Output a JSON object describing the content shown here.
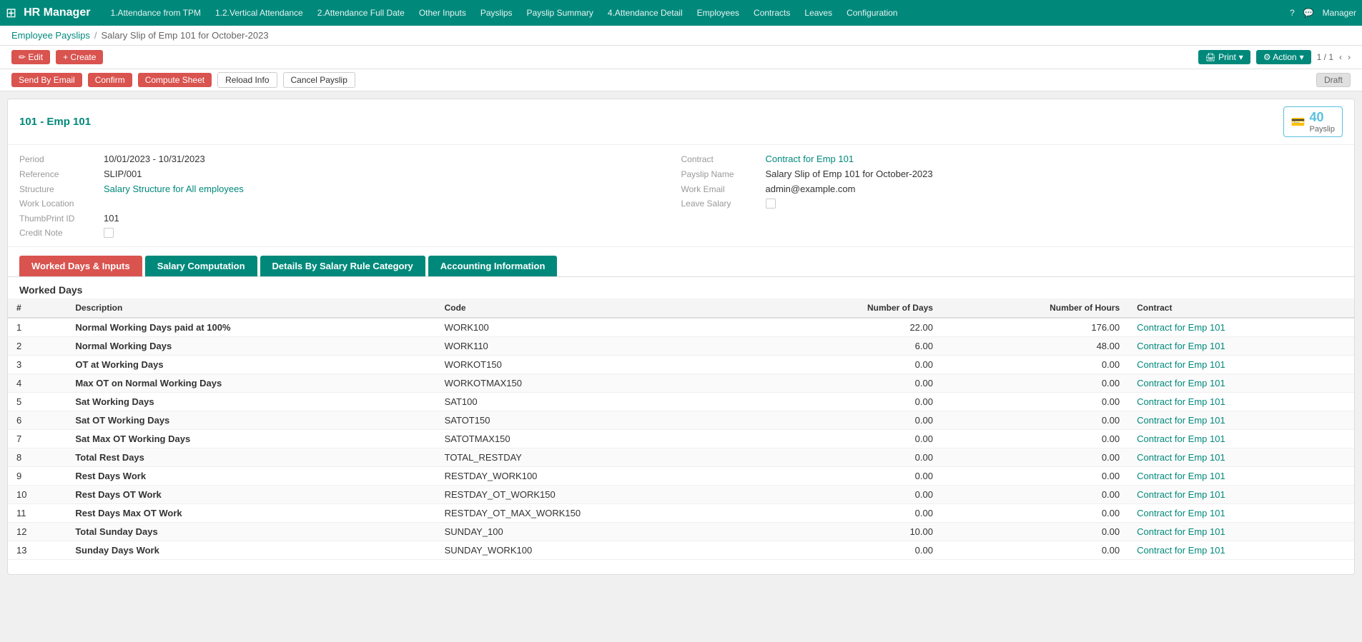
{
  "app": {
    "title": "HR Manager",
    "grid_icon": "⊞"
  },
  "nav": {
    "links": [
      {
        "label": "1.Attendance from TPM",
        "active": false
      },
      {
        "label": "1.2.Vertical Attendance",
        "active": false
      },
      {
        "label": "2.Attendance Full Date",
        "active": false
      },
      {
        "label": "Other Inputs",
        "active": false
      },
      {
        "label": "Payslips",
        "active": false
      },
      {
        "label": "Payslip Summary",
        "active": false
      },
      {
        "label": "4.Attendance Detail",
        "active": false
      },
      {
        "label": "Employees",
        "active": false
      },
      {
        "label": "Contracts",
        "active": false
      },
      {
        "label": "Leaves",
        "active": false
      },
      {
        "label": "Configuration",
        "active": false
      }
    ],
    "right": {
      "help_icon": "?",
      "chat_icon": "💬",
      "user_label": "Manager"
    }
  },
  "breadcrumb": {
    "parent_label": "Employee Payslips",
    "separator": "/",
    "current": "Salary Slip of Emp 101 for October-2023"
  },
  "toolbar": {
    "edit_label": "✏ Edit",
    "create_label": "+ Create",
    "print_label": "🖨 Print",
    "action_label": "⚙ Action",
    "pagination": "1 / 1"
  },
  "status_buttons": {
    "send_by_email": "Send By Email",
    "confirm": "Confirm",
    "compute_sheet": "Compute Sheet",
    "reload_info": "Reload Info",
    "cancel_payslip": "Cancel Payslip",
    "draft": "Draft"
  },
  "employee": {
    "code": "101",
    "name": "Emp 101",
    "payslip_count": "40",
    "payslip_label": "Payslip"
  },
  "form": {
    "left": {
      "period_label": "Period",
      "period_value": "10/01/2023 - 10/31/2023",
      "reference_label": "Reference",
      "reference_value": "SLIP/001",
      "structure_label": "Structure",
      "structure_value": "Salary Structure for All employees",
      "work_location_label": "Work Location",
      "work_location_value": "",
      "thumbprint_label": "ThumbPrint ID",
      "thumbprint_value": "101",
      "credit_note_label": "Credit Note"
    },
    "right": {
      "contract_label": "Contract",
      "contract_value": "Contract for Emp 101",
      "payslip_name_label": "Payslip Name",
      "payslip_name_value": "Salary Slip of Emp 101 for October-2023",
      "work_email_label": "Work Email",
      "work_email_value": "admin@example.com",
      "leave_salary_label": "Leave Salary"
    }
  },
  "tabs": [
    {
      "label": "Worked Days & Inputs",
      "active": true
    },
    {
      "label": "Salary Computation",
      "active": false
    },
    {
      "label": "Details By Salary Rule Category",
      "active": false
    },
    {
      "label": "Accounting Information",
      "active": false
    }
  ],
  "worked_days_section": {
    "title": "Worked Days",
    "columns": [
      "#",
      "Description",
      "Code",
      "Number of Days",
      "Number of Hours",
      "Contract"
    ],
    "rows": [
      {
        "num": "1",
        "description": "Normal Working Days paid at 100%",
        "code": "WORK100",
        "days": "22.00",
        "hours": "176.00",
        "contract": "Contract for Emp 101"
      },
      {
        "num": "2",
        "description": "Normal Working Days",
        "code": "WORK110",
        "days": "6.00",
        "hours": "48.00",
        "contract": "Contract for Emp 101"
      },
      {
        "num": "3",
        "description": "OT at Working Days",
        "code": "WORKOT150",
        "days": "0.00",
        "hours": "0.00",
        "contract": "Contract for Emp 101"
      },
      {
        "num": "4",
        "description": "Max OT on Normal Working Days",
        "code": "WORKOTMAX150",
        "days": "0.00",
        "hours": "0.00",
        "contract": "Contract for Emp 101"
      },
      {
        "num": "5",
        "description": "Sat Working Days",
        "code": "SAT100",
        "days": "0.00",
        "hours": "0.00",
        "contract": "Contract for Emp 101"
      },
      {
        "num": "6",
        "description": "Sat OT Working Days",
        "code": "SATOT150",
        "days": "0.00",
        "hours": "0.00",
        "contract": "Contract for Emp 101"
      },
      {
        "num": "7",
        "description": "Sat Max OT Working Days",
        "code": "SATOTMAX150",
        "days": "0.00",
        "hours": "0.00",
        "contract": "Contract for Emp 101"
      },
      {
        "num": "8",
        "description": "Total Rest Days",
        "code": "TOTAL_RESTDAY",
        "days": "0.00",
        "hours": "0.00",
        "contract": "Contract for Emp 101"
      },
      {
        "num": "9",
        "description": "Rest Days Work",
        "code": "RESTDAY_WORK100",
        "days": "0.00",
        "hours": "0.00",
        "contract": "Contract for Emp 101"
      },
      {
        "num": "10",
        "description": "Rest Days OT Work",
        "code": "RESTDAY_OT_WORK150",
        "days": "0.00",
        "hours": "0.00",
        "contract": "Contract for Emp 101"
      },
      {
        "num": "11",
        "description": "Rest Days Max OT Work",
        "code": "RESTDAY_OT_MAX_WORK150",
        "days": "0.00",
        "hours": "0.00",
        "contract": "Contract for Emp 101"
      },
      {
        "num": "12",
        "description": "Total Sunday Days",
        "code": "SUNDAY_100",
        "days": "10.00",
        "hours": "0.00",
        "contract": "Contract for Emp 101"
      },
      {
        "num": "13",
        "description": "Sunday Days Work",
        "code": "SUNDAY_WORK100",
        "days": "0.00",
        "hours": "0.00",
        "contract": "Contract for Emp 101"
      }
    ]
  }
}
